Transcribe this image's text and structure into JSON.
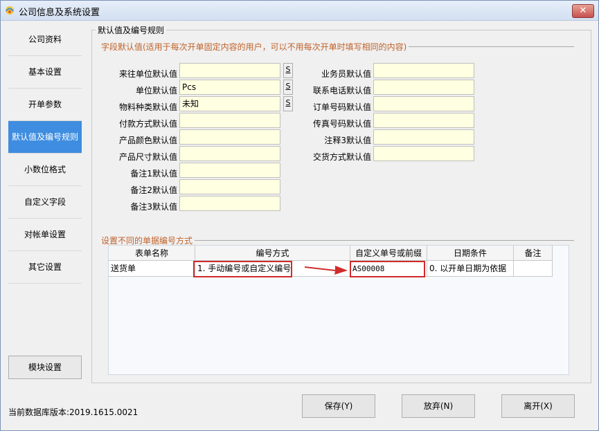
{
  "window": {
    "title": "公司信息及系统设置",
    "close": "✕"
  },
  "sidebar": {
    "items": [
      "公司资料",
      "基本设置",
      "开单参数",
      "默认值及编号规则",
      "小数位格式",
      "自定义字段",
      "对帐单设置",
      "其它设置"
    ],
    "active_index": 3,
    "module_button": "模块设置"
  },
  "footer": {
    "db_version": "当前数据库版本:2019.1615.0021",
    "save": "保存(Y)",
    "discard": "放弃(N)",
    "leave": "离开(X)"
  },
  "main": {
    "group_title": "默认值及编号规则",
    "field_section": "字段默认值(适用于每次开单固定内容的用户，可以不用每次开单时填写相同的内容)",
    "left_fields": [
      {
        "label": "来往单位默认值",
        "value": ""
      },
      {
        "label": "单位默认值",
        "value": "Pcs"
      },
      {
        "label": "物料种类默认值",
        "value": "未知"
      },
      {
        "label": "付款方式默认值",
        "value": ""
      },
      {
        "label": "产品颜色默认值",
        "value": ""
      },
      {
        "label": "产品尺寸默认值",
        "value": ""
      },
      {
        "label": "备注1默认值",
        "value": ""
      },
      {
        "label": "备注2默认值",
        "value": ""
      },
      {
        "label": "备注3默认值",
        "value": ""
      }
    ],
    "s_button": "S",
    "right_fields": [
      {
        "label": "业务员默认值",
        "value": ""
      },
      {
        "label": "联系电话默认值",
        "value": ""
      },
      {
        "label": "订单号码默认值",
        "value": ""
      },
      {
        "label": "传真号码默认值",
        "value": ""
      },
      {
        "label": "注释3默认值",
        "value": ""
      },
      {
        "label": "交货方式默认值",
        "value": ""
      }
    ],
    "numbering_section": "设置不同的单据编号方式",
    "grid": {
      "headers": [
        "表单名称",
        "编号方式",
        "自定义单号或前缀",
        "日期条件",
        "备注"
      ],
      "rows": [
        [
          "送货单",
          "1. 手动编号或自定义编号",
          "AS00008",
          "0. 以开单日期为依据",
          ""
        ]
      ]
    }
  },
  "colors": {
    "accent": "#3e8de0",
    "field_bg": "#ffffe1",
    "highlight": "#d12a2a",
    "section_title": "#c0622a"
  }
}
